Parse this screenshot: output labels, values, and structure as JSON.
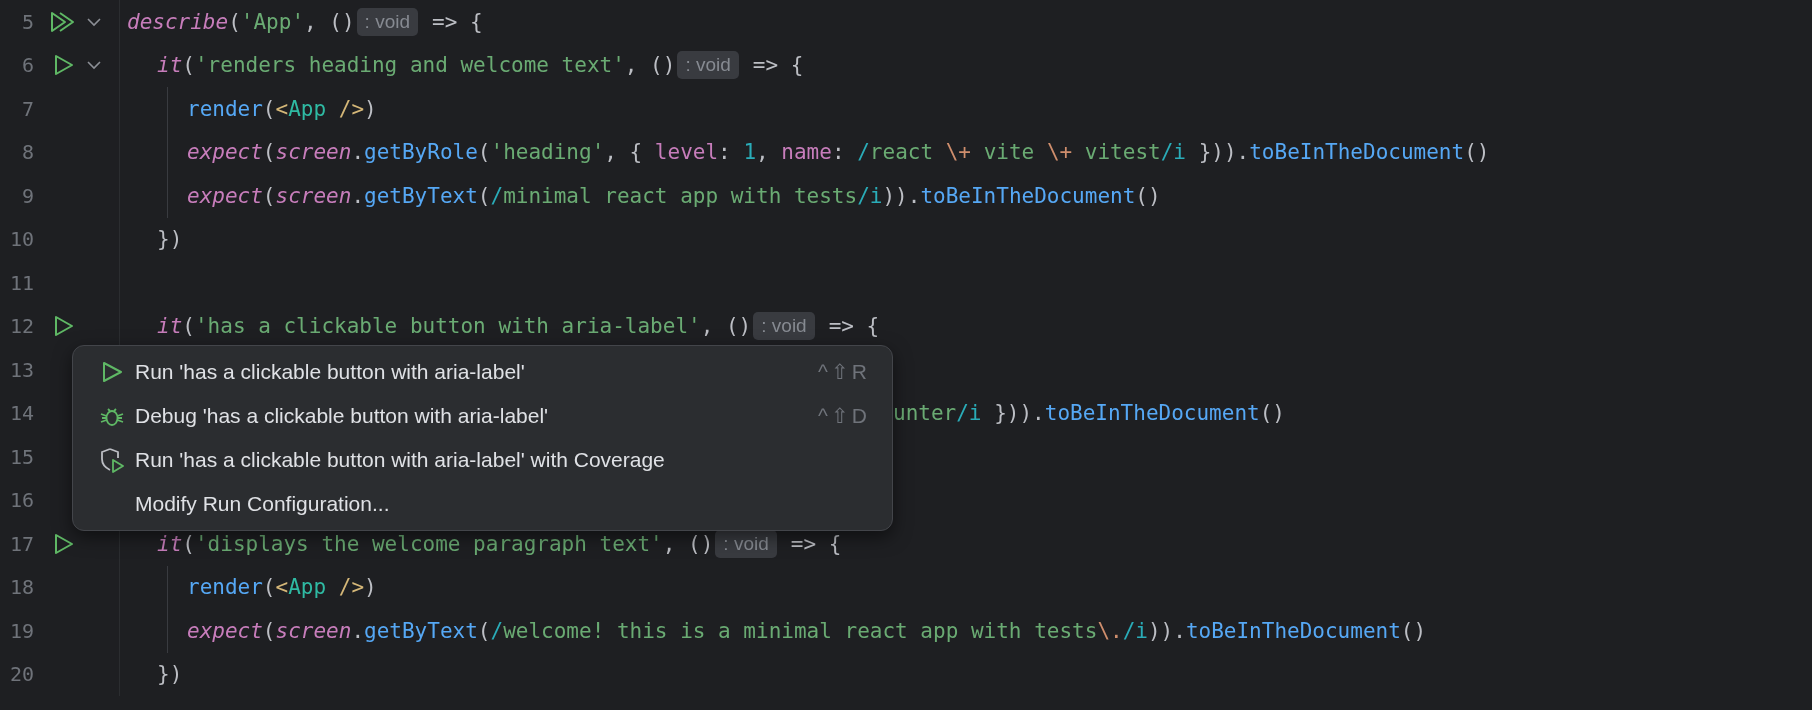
{
  "editor": {
    "lines": [
      {
        "num": "5",
        "kind": "suite",
        "expanded": true,
        "tokens": [
          {
            "kind": "f",
            "t": "describe"
          },
          {
            "kind": "p",
            "t": "("
          },
          {
            "kind": "s",
            "t": "'App'"
          },
          {
            "kind": "p",
            "t": ", ()"
          },
          {
            "kind": "h",
            "t": ": void"
          },
          {
            "kind": "p",
            "t": "=> {"
          }
        ],
        "children": [
          {
            "num": "6",
            "kind": "test",
            "expanded": true,
            "tokens": [
              {
                "kind": "f",
                "t": "it"
              },
              {
                "kind": "p",
                "t": "("
              },
              {
                "kind": "s",
                "t": "'renders heading and welcome text'"
              },
              {
                "kind": "p",
                "t": ", ()"
              },
              {
                "kind": "h",
                "t": ": void"
              },
              {
                "kind": "p",
                "t": "=> {"
              }
            ],
            "children": [
              {
                "num": "7",
                "tokens": [
                  {
                    "kind": "m",
                    "t": "render"
                  },
                  {
                    "kind": "p",
                    "t": "("
                  },
                  {
                    "kind": "t",
                    "t": "<"
                  },
                  {
                    "kind": "c",
                    "t": "App"
                  },
                  {
                    "kind": "t",
                    "t": " />"
                  },
                  {
                    "kind": "p",
                    "t": ")"
                  }
                ]
              },
              {
                "num": "8",
                "tokens": [
                  {
                    "kind": "f",
                    "t": "expect"
                  },
                  {
                    "kind": "p",
                    "t": "("
                  },
                  {
                    "kind": "f",
                    "t": "screen"
                  },
                  {
                    "kind": "p",
                    "t": "."
                  },
                  {
                    "kind": "m",
                    "t": "getByRole"
                  },
                  {
                    "kind": "p",
                    "t": "("
                  },
                  {
                    "kind": "s",
                    "t": "'heading'"
                  },
                  {
                    "kind": "p",
                    "t": ", { "
                  },
                  {
                    "kind": "k",
                    "t": "level"
                  },
                  {
                    "kind": "p",
                    "t": ": "
                  },
                  {
                    "kind": "n",
                    "t": "1"
                  },
                  {
                    "kind": "p",
                    "t": ", "
                  },
                  {
                    "kind": "k",
                    "t": "name"
                  },
                  {
                    "kind": "p",
                    "t": ": "
                  },
                  {
                    "kind": "r",
                    "t": "/"
                  },
                  {
                    "kind": "s",
                    "t": "react "
                  },
                  {
                    "kind": "e",
                    "t": "\\+"
                  },
                  {
                    "kind": "s",
                    "t": " vite "
                  },
                  {
                    "kind": "e",
                    "t": "\\+"
                  },
                  {
                    "kind": "s",
                    "t": " vitest"
                  },
                  {
                    "kind": "r",
                    "t": "/i"
                  },
                  {
                    "kind": "p",
                    "t": " }))."
                  },
                  {
                    "kind": "m",
                    "t": "toBeInTheDocument"
                  },
                  {
                    "kind": "p",
                    "t": "()"
                  }
                ]
              },
              {
                "num": "9",
                "tokens": [
                  {
                    "kind": "f",
                    "t": "expect"
                  },
                  {
                    "kind": "p",
                    "t": "("
                  },
                  {
                    "kind": "f",
                    "t": "screen"
                  },
                  {
                    "kind": "p",
                    "t": "."
                  },
                  {
                    "kind": "m",
                    "t": "getByText"
                  },
                  {
                    "kind": "p",
                    "t": "("
                  },
                  {
                    "kind": "r",
                    "t": "/"
                  },
                  {
                    "kind": "s",
                    "t": "minimal react app with tests"
                  },
                  {
                    "kind": "r",
                    "t": "/i"
                  },
                  {
                    "kind": "p",
                    "t": "))."
                  },
                  {
                    "kind": "m",
                    "t": "toBeInTheDocument"
                  },
                  {
                    "kind": "p",
                    "t": "()"
                  }
                ]
              }
            ]
          },
          {
            "num": "10",
            "tokens": [
              {
                "kind": "p",
                "t": "})"
              }
            ]
          },
          {
            "num": "11"
          },
          {
            "num": "12",
            "kind": "test",
            "tokens": [
              {
                "kind": "f",
                "t": "it"
              },
              {
                "kind": "p",
                "t": "("
              },
              {
                "kind": "s",
                "t": "'has a clickable button with aria-label'"
              },
              {
                "kind": "p",
                "t": ", ()"
              },
              {
                "kind": "h",
                "t": ": void"
              },
              {
                "kind": "p",
                "t": "=> {"
              }
            ],
            "children": [
              {
                "num": "13"
              },
              {
                "num": "14",
                "kind": "clipped",
                "tokens": [
                  {
                    "kind": "s",
                    "t": "unter"
                  },
                  {
                    "kind": "r",
                    "t": "/i"
                  },
                  {
                    "kind": "p",
                    "t": " }))."
                  },
                  {
                    "kind": "m",
                    "t": "toBeInTheDocument"
                  },
                  {
                    "kind": "p",
                    "t": "()"
                  }
                ]
              },
              {
                "num": "15"
              }
            ]
          },
          {
            "num": "16"
          },
          {
            "num": "17",
            "kind": "test",
            "tokens": [
              {
                "kind": "f",
                "t": "it"
              },
              {
                "kind": "p",
                "t": "("
              },
              {
                "kind": "s",
                "t": "'displays the welcome paragraph text'"
              },
              {
                "kind": "p",
                "t": ", ()"
              },
              {
                "kind": "h",
                "t": ": void"
              },
              {
                "kind": "p",
                "t": "=> {"
              }
            ],
            "children": [
              {
                "num": "18",
                "tokens": [
                  {
                    "kind": "m",
                    "t": "render"
                  },
                  {
                    "kind": "p",
                    "t": "("
                  },
                  {
                    "kind": "t",
                    "t": "<"
                  },
                  {
                    "kind": "c",
                    "t": "App"
                  },
                  {
                    "kind": "t",
                    "t": " />"
                  },
                  {
                    "kind": "p",
                    "t": ")"
                  }
                ]
              },
              {
                "num": "19",
                "tokens": [
                  {
                    "kind": "f",
                    "t": "expect"
                  },
                  {
                    "kind": "p",
                    "t": "("
                  },
                  {
                    "kind": "f",
                    "t": "screen"
                  },
                  {
                    "kind": "p",
                    "t": "."
                  },
                  {
                    "kind": "m",
                    "t": "getByText"
                  },
                  {
                    "kind": "p",
                    "t": "("
                  },
                  {
                    "kind": "r",
                    "t": "/"
                  },
                  {
                    "kind": "s",
                    "t": "welcome! this is a minimal react app with tests"
                  },
                  {
                    "kind": "e",
                    "t": "\\."
                  },
                  {
                    "kind": "r",
                    "t": "/i"
                  },
                  {
                    "kind": "p",
                    "t": "))."
                  },
                  {
                    "kind": "m",
                    "t": "toBeInTheDocument"
                  },
                  {
                    "kind": "p",
                    "t": "()"
                  }
                ]
              }
            ]
          },
          {
            "num": "20",
            "tokens": [
              {
                "kind": "p",
                "t": "})"
              }
            ]
          }
        ]
      }
    ]
  },
  "popup": {
    "items": [
      {
        "kind": "run",
        "label": "Run 'has a clickable button with aria-label'",
        "shortcut": "^⇧R"
      },
      {
        "kind": "debug",
        "label": "Debug 'has a clickable button with aria-label'",
        "shortcut": "^⇧D"
      },
      {
        "kind": "coverage",
        "label": "Run 'has a clickable button with aria-label' with Coverage"
      },
      {
        "kind": "plain",
        "label": "Modify Run Configuration..."
      }
    ]
  }
}
